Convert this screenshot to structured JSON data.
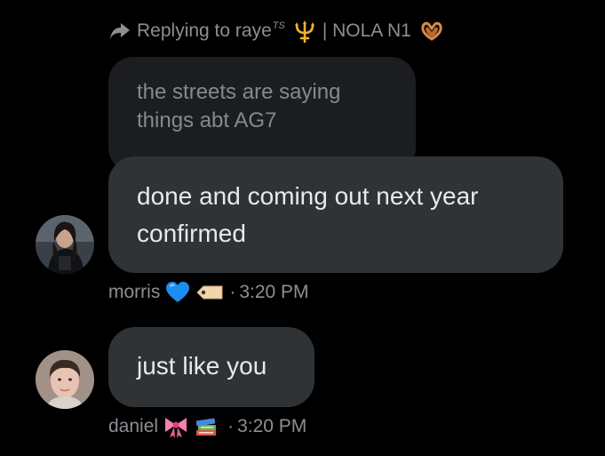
{
  "reply_header": {
    "prefix": "Replying to raye",
    "superscript": "TS",
    "suffix": "| NOLA N1",
    "icons": [
      "reply-arrow-icon",
      "trident-emoji",
      "heart-hands-emoji"
    ]
  },
  "quoted_message": {
    "text": "the streets are saying things abt AG7"
  },
  "messages": [
    {
      "sender": "morris",
      "text": "done and coming out next year confirmed",
      "time": "3:20 PM",
      "sender_emojis": [
        "blue-heart-emoji",
        "label-tag-emoji"
      ]
    },
    {
      "sender": "daniel",
      "text": "just like you",
      "time": "3:20 PM",
      "sender_emojis": [
        "ribbon-emoji",
        "books-emoji"
      ]
    }
  ],
  "separator": "·",
  "colors": {
    "background": "#000000",
    "bubble": "#2f3336",
    "quoted_bubble": "#1c1d20",
    "muted_text": "#8b8f94",
    "primary_text": "#e7e9ea",
    "blue_heart": "#1d8cf0",
    "ribbon": "#f47fb0"
  }
}
